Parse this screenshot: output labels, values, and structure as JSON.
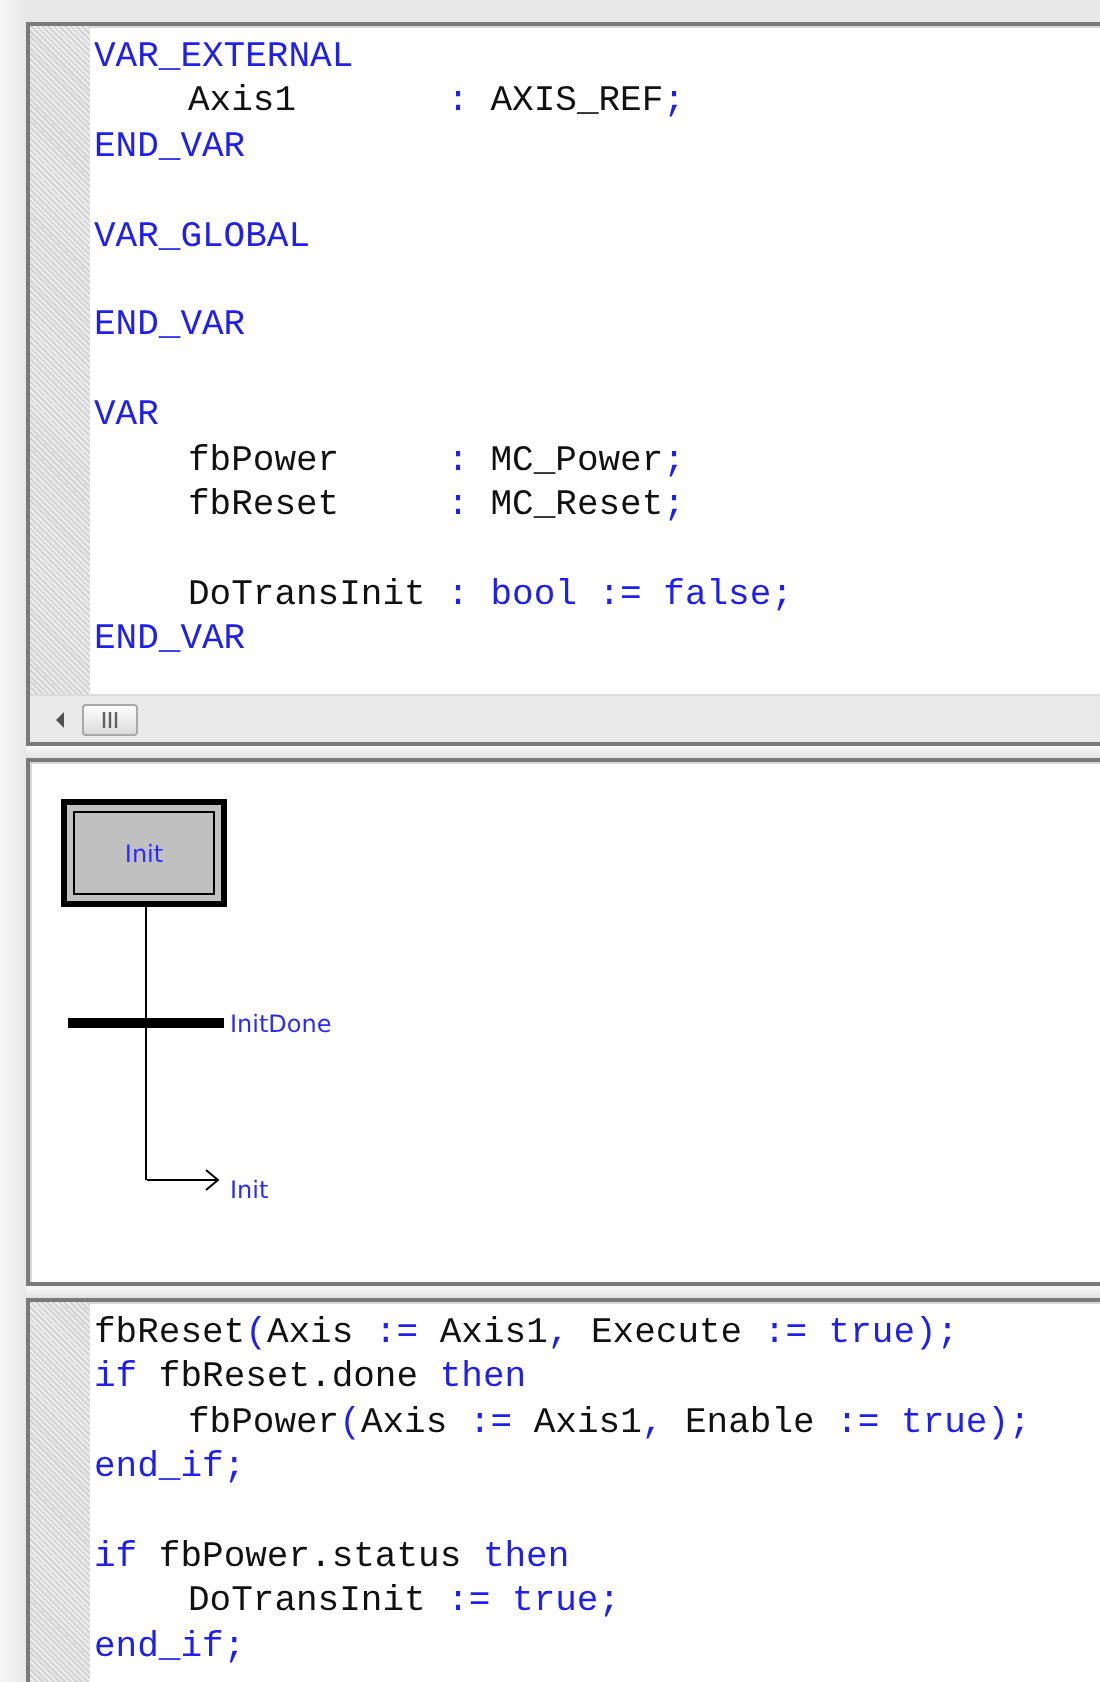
{
  "declarations": {
    "lines": [
      {
        "kind": "code",
        "tokens": [
          {
            "text": "VAR_EXTERNAL",
            "kind": "keyword"
          }
        ]
      },
      {
        "kind": "indented",
        "tokens": [
          {
            "text": "Axis1       ",
            "kind": "plain"
          },
          {
            "text": ":",
            "kind": "keyword"
          },
          {
            "text": " AXIS_REF",
            "kind": "plain"
          },
          {
            "text": ";",
            "kind": "keyword"
          }
        ]
      },
      {
        "kind": "code",
        "tokens": [
          {
            "text": "END_VAR",
            "kind": "keyword"
          }
        ]
      },
      {
        "kind": "blank"
      },
      {
        "kind": "code",
        "tokens": [
          {
            "text": "VAR_GLOBAL",
            "kind": "keyword"
          }
        ]
      },
      {
        "kind": "blank"
      },
      {
        "kind": "code",
        "tokens": [
          {
            "text": "END_VAR",
            "kind": "keyword"
          }
        ]
      },
      {
        "kind": "blank"
      },
      {
        "kind": "code",
        "tokens": [
          {
            "text": "VAR",
            "kind": "keyword"
          }
        ]
      },
      {
        "kind": "indented",
        "tokens": [
          {
            "text": "fbPower     ",
            "kind": "plain"
          },
          {
            "text": ":",
            "kind": "keyword"
          },
          {
            "text": " MC_Power",
            "kind": "plain"
          },
          {
            "text": ";",
            "kind": "keyword"
          }
        ]
      },
      {
        "kind": "indented",
        "tokens": [
          {
            "text": "fbReset     ",
            "kind": "plain"
          },
          {
            "text": ":",
            "kind": "keyword"
          },
          {
            "text": " MC_Reset",
            "kind": "plain"
          },
          {
            "text": ";",
            "kind": "keyword"
          }
        ]
      },
      {
        "kind": "blank"
      },
      {
        "kind": "indented",
        "tokens": [
          {
            "text": "DoTransInit ",
            "kind": "plain"
          },
          {
            "text": ": bool := false;",
            "kind": "keyword"
          }
        ]
      },
      {
        "kind": "code",
        "tokens": [
          {
            "text": "END_VAR",
            "kind": "keyword"
          }
        ]
      }
    ]
  },
  "diagram": {
    "step": {
      "label": "Init",
      "initial": true
    },
    "transition": {
      "condition": "InitDone"
    },
    "jump": {
      "target": "Init"
    }
  },
  "code": {
    "lines": [
      {
        "kind": "code",
        "tokens": [
          {
            "text": "fbReset",
            "kind": "plain"
          },
          {
            "text": "(",
            "kind": "keyword"
          },
          {
            "text": "Axis ",
            "kind": "plain"
          },
          {
            "text": ":=",
            "kind": "keyword"
          },
          {
            "text": " Axis1",
            "kind": "plain"
          },
          {
            "text": ",",
            "kind": "keyword"
          },
          {
            "text": " Execute ",
            "kind": "plain"
          },
          {
            "text": ":= true);",
            "kind": "keyword"
          }
        ]
      },
      {
        "kind": "code",
        "tokens": [
          {
            "text": "if",
            "kind": "keyword"
          },
          {
            "text": " fbReset.done ",
            "kind": "plain"
          },
          {
            "text": "then",
            "kind": "keyword"
          }
        ]
      },
      {
        "kind": "indented",
        "tokens": [
          {
            "text": "fbPower",
            "kind": "plain"
          },
          {
            "text": "(",
            "kind": "keyword"
          },
          {
            "text": "Axis ",
            "kind": "plain"
          },
          {
            "text": ":=",
            "kind": "keyword"
          },
          {
            "text": " Axis1",
            "kind": "plain"
          },
          {
            "text": ",",
            "kind": "keyword"
          },
          {
            "text": " Enable ",
            "kind": "plain"
          },
          {
            "text": ":= true);",
            "kind": "keyword"
          }
        ]
      },
      {
        "kind": "code",
        "tokens": [
          {
            "text": "end_if;",
            "kind": "keyword"
          }
        ]
      },
      {
        "kind": "blank"
      },
      {
        "kind": "code",
        "tokens": [
          {
            "text": "if",
            "kind": "keyword"
          },
          {
            "text": " fbPower.status ",
            "kind": "plain"
          },
          {
            "text": "then",
            "kind": "keyword"
          }
        ]
      },
      {
        "kind": "indented",
        "tokens": [
          {
            "text": "DoTransInit ",
            "kind": "plain"
          },
          {
            "text": ":= true;",
            "kind": "keyword"
          }
        ]
      },
      {
        "kind": "code",
        "tokens": [
          {
            "text": "end_if;",
            "kind": "keyword"
          }
        ]
      }
    ]
  }
}
